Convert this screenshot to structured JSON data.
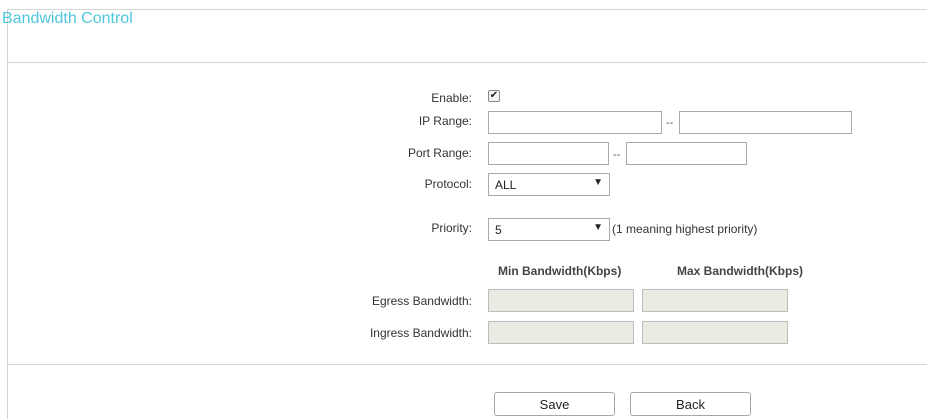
{
  "page": {
    "title": "Bandwidth Control"
  },
  "form": {
    "enable": {
      "label": "Enable:",
      "checked": true,
      "check_glyph": "✔"
    },
    "ip_range": {
      "label": "IP Range:",
      "start": "",
      "end": "",
      "separator": "--"
    },
    "port_range": {
      "label": "Port Range:",
      "start": "",
      "end": "",
      "separator": "--"
    },
    "protocol": {
      "label": "Protocol:",
      "value": "ALL"
    },
    "priority": {
      "label": "Priority:",
      "value": "5",
      "hint": "(1 meaning highest priority)"
    },
    "columns": {
      "min": "Min Bandwidth(Kbps)",
      "max": "Max Bandwidth(Kbps)"
    },
    "egress": {
      "label": "Egress Bandwidth:",
      "min": "",
      "max": ""
    },
    "ingress": {
      "label": "Ingress Bandwidth:",
      "min": "",
      "max": ""
    }
  },
  "buttons": {
    "save": "Save",
    "back": "Back"
  },
  "icons": {
    "dropdown_arrow": "▼"
  },
  "colors": {
    "title": "#4fc6dd",
    "disabled_field": "#ebebe4",
    "border": "#d4d4d4"
  }
}
